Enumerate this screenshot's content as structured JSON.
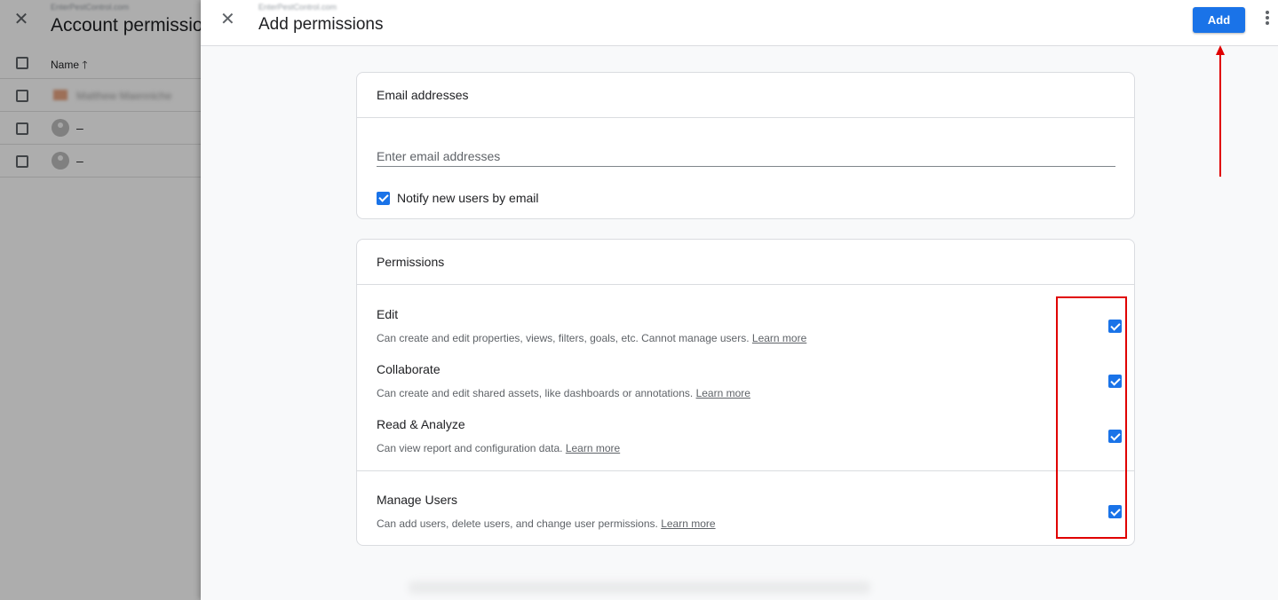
{
  "background": {
    "subtitle": "EnterPestControl.com",
    "title": "Account permissions",
    "name_header": "Name",
    "sort_icon": "arrow-up",
    "rows": [
      {
        "name": "Matthew Maenniche",
        "avatar": "photo"
      },
      {
        "name": "–",
        "avatar": "person-icon"
      },
      {
        "name": "–",
        "avatar": "person-icon"
      }
    ]
  },
  "panel": {
    "subtitle": "EnterPestControl.com",
    "title": "Add permissions",
    "add_label": "Add"
  },
  "email_card": {
    "title": "Email addresses",
    "placeholder": "Enter email addresses",
    "notify_label": "Notify new users by email",
    "notify_checked": true
  },
  "permissions_card": {
    "title": "Permissions",
    "items": [
      {
        "name": "Edit",
        "description": "Can create and edit properties, views, filters, goals, etc. Cannot manage users.",
        "link": "Learn more",
        "checked": true
      },
      {
        "name": "Collaborate",
        "description": "Can create and edit shared assets, like dashboards or annotations.",
        "link": "Learn more",
        "checked": true
      },
      {
        "name": "Read & Analyze",
        "description": "Can view report and configuration data.",
        "link": "Learn more",
        "checked": true
      },
      {
        "name": "Manage Users",
        "description": "Can add users, delete users, and change user permissions.",
        "link": "Learn more",
        "checked": true
      }
    ]
  },
  "colors": {
    "accent": "#1a73e8",
    "annotation": "#e00000"
  }
}
